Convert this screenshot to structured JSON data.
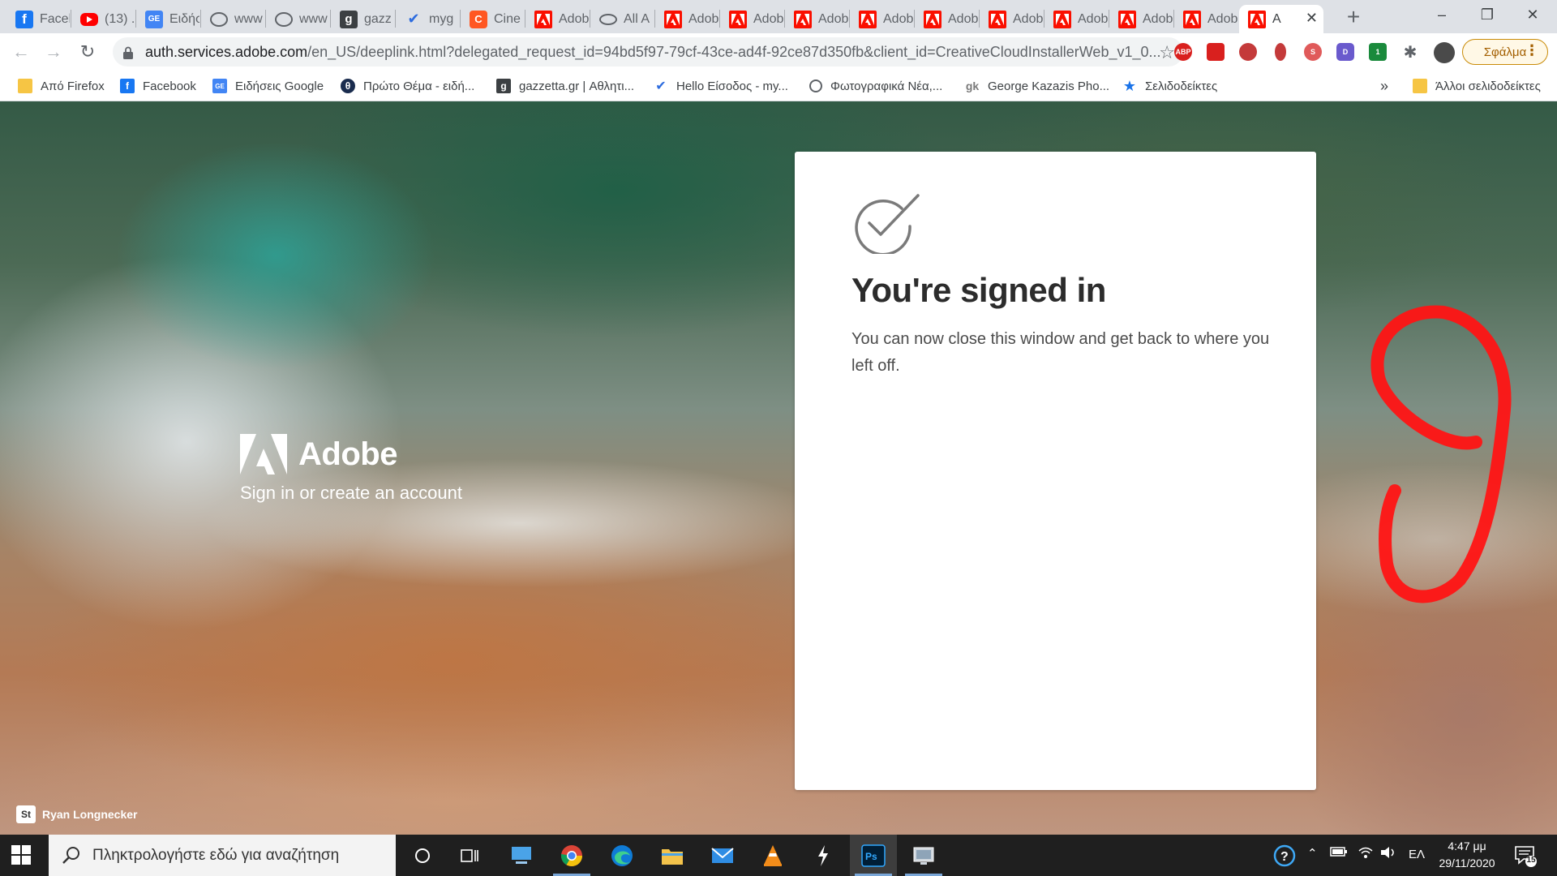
{
  "tabs": [
    {
      "title": "Facebook",
      "favicon": "facebook-icon"
    },
    {
      "title": "(13) ...",
      "favicon": "youtube-icon"
    },
    {
      "title": "Ειδήσεις",
      "favicon": "google-news-icon"
    },
    {
      "title": "www",
      "favicon": "globe-icon"
    },
    {
      "title": "www",
      "favicon": "globe-icon"
    },
    {
      "title": "gazz",
      "favicon": "gazzetta-icon"
    },
    {
      "title": "myg",
      "favicon": "mygreece-icon"
    },
    {
      "title": "Cine",
      "favicon": "cine-icon"
    },
    {
      "title": "Adobe",
      "favicon": "adobe-icon"
    },
    {
      "title": "All A",
      "favicon": "all-icon"
    },
    {
      "title": "Adobe",
      "favicon": "adobe-icon"
    },
    {
      "title": "Adobe",
      "favicon": "adobe-icon"
    },
    {
      "title": "Adobe",
      "favicon": "adobe-icon"
    },
    {
      "title": "Adobe",
      "favicon": "adobe-icon"
    },
    {
      "title": "Adobe",
      "favicon": "adobe-icon"
    },
    {
      "title": "Adobe",
      "favicon": "adobe-icon"
    },
    {
      "title": "Adobe",
      "favicon": "adobe-icon"
    },
    {
      "title": "Adobe",
      "favicon": "adobe-icon"
    },
    {
      "title": "Adobe",
      "favicon": "adobe-icon"
    },
    {
      "title": "A",
      "favicon": "adobe-icon",
      "active": true
    }
  ],
  "toolbar": {
    "url_host": "auth.services.adobe.com",
    "url_path": "/en_US/deeplink.html?delegated_request_id=94bd5f97-79cf-43ce-ad4f-92ce87d350fb&client_id=CreativeCloudInstallerWeb_v1_0...",
    "extensions": [
      "ABP",
      "",
      "",
      "",
      "S",
      "D",
      "1"
    ],
    "sync_label": "Σφάλμα"
  },
  "bookmarks": [
    {
      "label": "Από Firefox",
      "icon": "folder-icon"
    },
    {
      "label": "Facebook",
      "icon": "facebook-icon"
    },
    {
      "label": "Ειδήσεις Google",
      "icon": "google-news-icon"
    },
    {
      "label": "Πρώτο Θέμα - ειδή...",
      "icon": "protothema-icon"
    },
    {
      "label": "gazzetta.gr | Αθλητι...",
      "icon": "gazzetta-icon"
    },
    {
      "label": "Hello Είσοδος - my...",
      "icon": "mygreece-icon"
    },
    {
      "label": "Φωτογραφικά Νέα,...",
      "icon": "globe-icon"
    },
    {
      "label": "George Kazazis Pho...",
      "icon": "gk-icon"
    },
    {
      "label": "Σελιδοδείκτες",
      "icon": "star-icon"
    }
  ],
  "bookmarks_overflow": "»",
  "other_bookmarks": "Άλλοι σελιδοδείκτες",
  "page": {
    "brand_name": "Adobe",
    "brand_tagline": "Sign in or create an account",
    "card_title": "You're signed in",
    "card_message": "You can now close this window and get back to where you left off.",
    "photo_credit_badge": "St",
    "photo_credit_name": "Ryan Longnecker"
  },
  "taskbar": {
    "search_placeholder": "Πληκτρολογήστε εδώ για αναζήτηση",
    "apps": [
      "cortana-icon",
      "task-view-icon",
      "computer-icon",
      "chrome-icon",
      "edge-icon",
      "file-explorer-icon",
      "mail-icon",
      "vlc-icon",
      "app-bolt-icon",
      "photoshop-icon",
      "screen-icon"
    ],
    "language": "ΕΛ",
    "time": "4:47 μμ",
    "date": "29/11/2020",
    "notification_count": "15"
  },
  "colors": {
    "adobe_red": "#fa0f00",
    "scribble_red": "#ff1414",
    "taskbar": "#1f1f1f"
  }
}
